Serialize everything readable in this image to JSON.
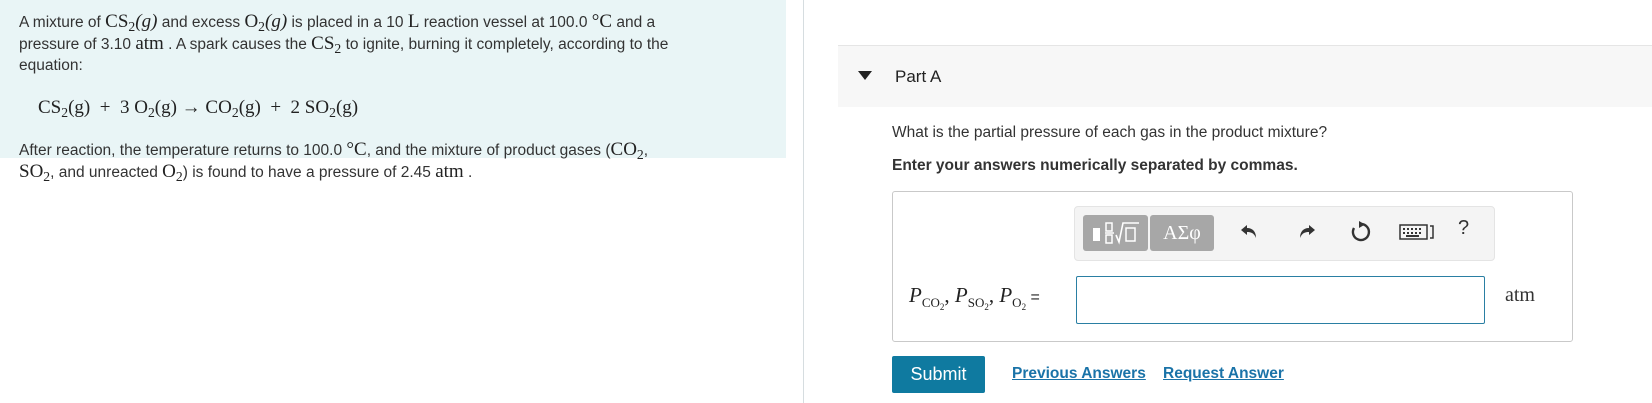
{
  "problem": {
    "line1": {
      "t1": "A mixture of ",
      "m1": "CS",
      "m1sub": "2",
      "m1b": "(g)",
      "t2": " and excess ",
      "m2": "O",
      "m2sub": "2",
      "m2b": "(g)",
      "t3": " is placed in a 10 ",
      "m3": "L",
      "t4": " reaction vessel at 100.0 ",
      "m4": "°C",
      "t5": " and a"
    },
    "line2": {
      "t1": "pressure of 3.10 ",
      "m1": "atm",
      "t2": " . A spark causes the ",
      "m2": "CS",
      "m2sub": "2",
      "t3": " to ignite, burning it completely, according to the"
    },
    "line3": "equation:",
    "equation": {
      "a": "CS",
      "asub": "2",
      "ab": "(g)  +  3 O",
      "bsub": "2",
      "bb": "(g) → CO",
      "csub": "2",
      "cb": "(g)  +  2 SO",
      "dsub": "2",
      "db": "(g)"
    },
    "line5": {
      "t1": "After reaction, the temperature returns to 100.0 ",
      "m1": "°C",
      "t2": ", and the mixture of product gases (",
      "m2": "CO",
      "m2sub": "2",
      "t3": ","
    },
    "line6": {
      "m1": "SO",
      "m1sub": "2",
      "t1": ", and unreacted ",
      "m2": "O",
      "m2sub": "2",
      "t2": ") is found to have a pressure of 2.45 ",
      "m3": "atm",
      "t3": " ."
    }
  },
  "part": {
    "title": "Part A"
  },
  "question": "What is the partial pressure of each gas in the product mixture?",
  "instruction": "Enter your answers numerically separated by commas.",
  "toolbar": {
    "templates_icon": "fraction-radical-templates-icon",
    "greek_label": "ΑΣφ",
    "undo_icon": "undo-icon",
    "redo_icon": "redo-icon",
    "reset_icon": "reset-icon",
    "keyboard_icon": "keyboard-icon",
    "help_label": "?"
  },
  "answer": {
    "label": {
      "p": "P",
      "s1": "CO",
      "s1sub": "2",
      "sep1": ", ",
      "s2": "SO",
      "s2sub": "2",
      "sep2": ", ",
      "s3": "O",
      "s3sub": "2",
      "eq": " ="
    },
    "value": "",
    "unit": "atm"
  },
  "actions": {
    "submit": "Submit",
    "previous_answers": "Previous Answers",
    "request_answer": "Request Answer"
  },
  "colors": {
    "problem_bg": "#e9f5f6",
    "submit_bg": "#0f7aa0",
    "link": "#1a73a8",
    "input_border": "#2a7fa3"
  }
}
